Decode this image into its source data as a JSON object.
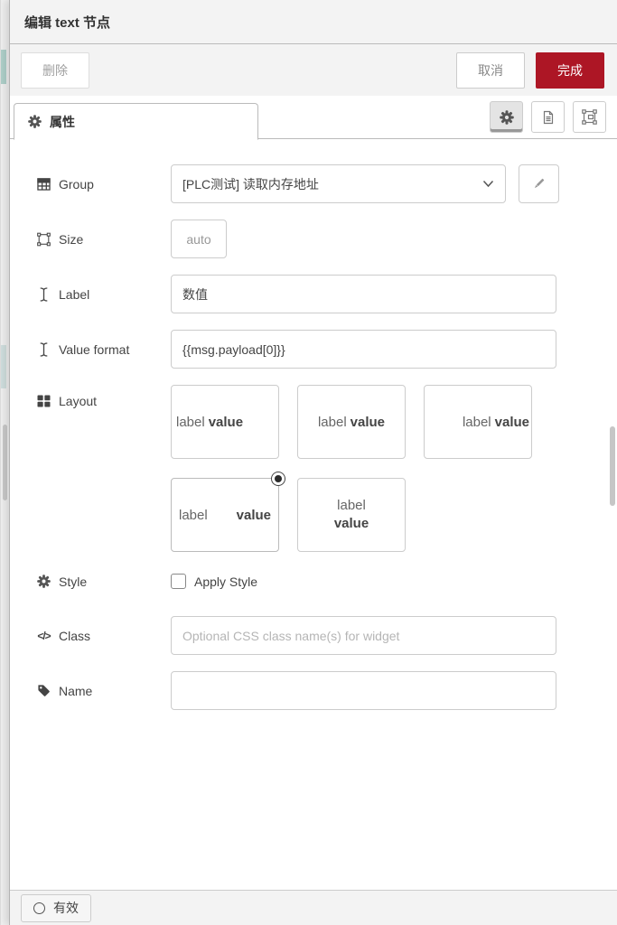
{
  "dialog": {
    "title": "编辑 text 节点",
    "toolbar": {
      "delete_label": "删除",
      "cancel_label": "取消",
      "done_label": "完成"
    },
    "tabs": {
      "properties_label": "属性"
    },
    "form": {
      "group": {
        "label": "Group",
        "selected_value": "[PLC测试] 读取内存地址"
      },
      "size": {
        "label": "Size",
        "value": "auto"
      },
      "label_field": {
        "label": "Label",
        "value": "数值"
      },
      "value_format": {
        "label": "Value format",
        "value": "{{msg.payload[0]}}"
      },
      "layout": {
        "label": "Layout",
        "word_label": "label",
        "word_value": "value",
        "selected_index": 3,
        "options": [
          "left",
          "center",
          "right",
          "spread",
          "stacked"
        ]
      },
      "style": {
        "label": "Style",
        "checkbox_label": "Apply Style",
        "checked": false
      },
      "class_field": {
        "label": "Class",
        "value": "",
        "placeholder": "Optional CSS class name(s) for widget"
      },
      "name_field": {
        "label": "Name",
        "value": ""
      }
    },
    "footer": {
      "enabled_label": "有效"
    },
    "icons": {
      "class_glyph": "</>"
    },
    "colors": {
      "accent_red": "#ad1625",
      "chrome_grey": "#f3f3f3",
      "border_grey": "#bbbbbb"
    }
  }
}
